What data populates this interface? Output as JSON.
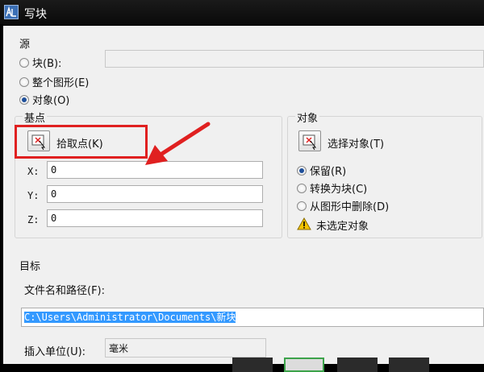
{
  "window": {
    "title": "写块"
  },
  "source": {
    "group_label": "源",
    "radio_block": "块(B):",
    "radio_entire": "整个图形(E)",
    "radio_objects": "对象(O)",
    "selected": "objects"
  },
  "base_point": {
    "group_label": "基点",
    "pick_button": "拾取点(K)",
    "x_label": "X:",
    "x_value": "0",
    "y_label": "Y:",
    "y_value": "0",
    "z_label": "Z:",
    "z_value": "0"
  },
  "objects": {
    "group_label": "对象",
    "select_button": "选择对象(T)",
    "radio_retain": "保留(R)",
    "radio_convert": "转换为块(C)",
    "radio_delete": "从图形中删除(D)",
    "selected": "retain",
    "warning_text": "未选定对象"
  },
  "destination": {
    "group_label": "目标",
    "path_label": "文件名和路径(F):",
    "path_value": "C:\\Users\\Administrator\\Documents\\新块",
    "units_label": "插入单位(U):",
    "units_value": "毫米"
  },
  "colors": {
    "highlight": "#e02020",
    "selection": "#3399ff",
    "warning": "#f5c400"
  }
}
